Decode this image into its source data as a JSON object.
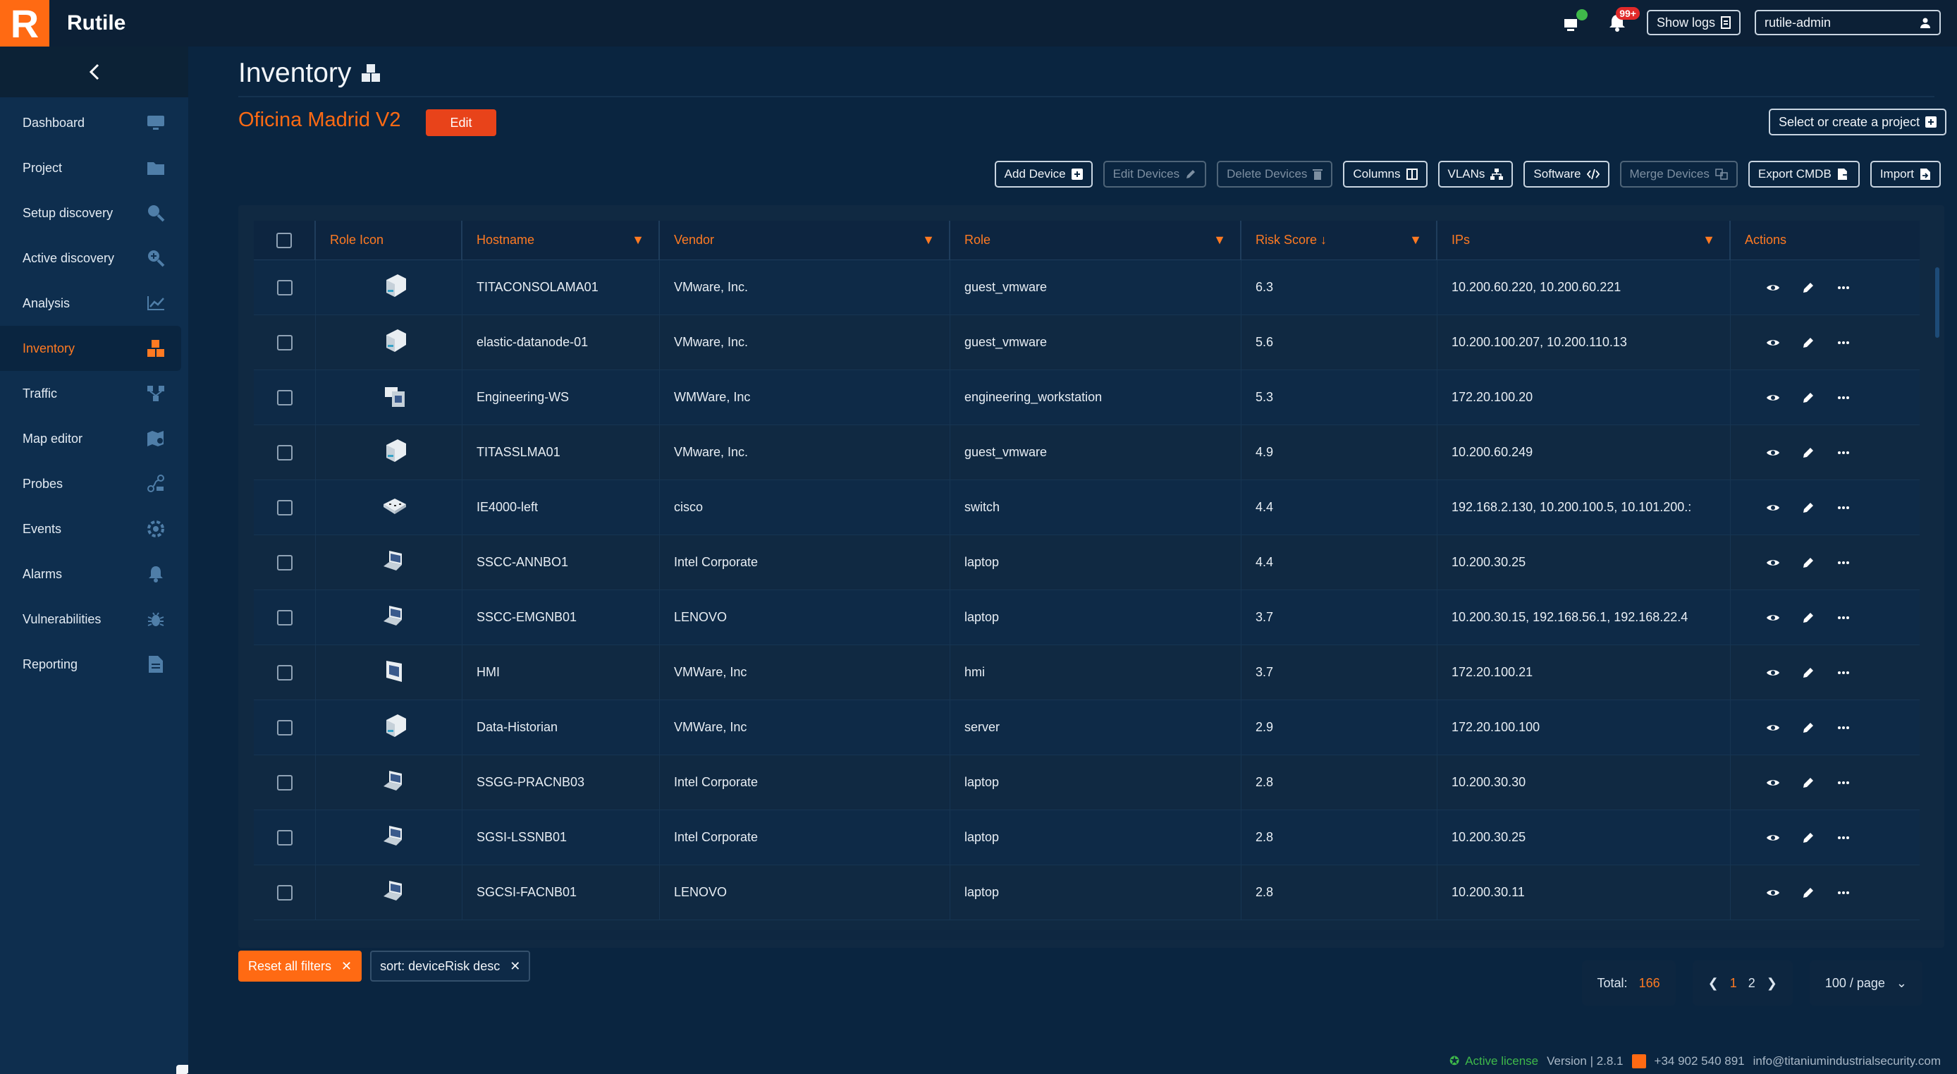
{
  "app": {
    "name": "Rutile",
    "logo_letter": "R"
  },
  "topbar": {
    "notif_badge": "99+",
    "show_logs": "Show logs",
    "user": "rutile-admin"
  },
  "sidebar": {
    "items": [
      {
        "label": "Dashboard",
        "icon": "monitor-icon"
      },
      {
        "label": "Project",
        "icon": "folder-icon"
      },
      {
        "label": "Setup discovery",
        "icon": "search-icon"
      },
      {
        "label": "Active discovery",
        "icon": "zoom-in-icon"
      },
      {
        "label": "Analysis",
        "icon": "chart-icon"
      },
      {
        "label": "Inventory",
        "icon": "inventory-icon",
        "active": true
      },
      {
        "label": "Traffic",
        "icon": "network-icon"
      },
      {
        "label": "Map editor",
        "icon": "map-icon"
      },
      {
        "label": "Probes",
        "icon": "probe-icon"
      },
      {
        "label": "Events",
        "icon": "gear-icon"
      },
      {
        "label": "Alarms",
        "icon": "bell-icon"
      },
      {
        "label": "Vulnerabilities",
        "icon": "bug-icon"
      },
      {
        "label": "Reporting",
        "icon": "document-icon"
      }
    ]
  },
  "page": {
    "title": "Inventory",
    "project_name": "Oficina Madrid V2",
    "edit_label": "Edit",
    "select_project": "Select or create a project"
  },
  "toolbar": {
    "add_device": "Add Device",
    "edit_devices": "Edit Devices",
    "delete_devices": "Delete Devices",
    "columns": "Columns",
    "vlans": "VLANs",
    "software": "Software",
    "merge_devices": "Merge Devices",
    "export_cmdb": "Export CMDB",
    "import": "Import"
  },
  "table": {
    "headers": [
      "Role Icon",
      "Hostname",
      "Vendor",
      "Role",
      "Risk Score",
      "IPs",
      "Actions"
    ],
    "rows": [
      {
        "icon": "vm",
        "hostname": "TITACONSOLAMA01",
        "vendor": "VMware, Inc.",
        "role": "guest_vmware",
        "risk": "6.3",
        "ips": "10.200.60.220, 10.200.60.221"
      },
      {
        "icon": "vm",
        "hostname": "elastic-datanode-01",
        "vendor": "VMware, Inc.",
        "role": "guest_vmware",
        "risk": "5.6",
        "ips": "10.200.100.207, 10.200.110.13"
      },
      {
        "icon": "ws",
        "hostname": "Engineering-WS",
        "vendor": "WMWare, Inc",
        "role": "engineering_workstation",
        "risk": "5.3",
        "ips": "172.20.100.20"
      },
      {
        "icon": "vm",
        "hostname": "TITASSLMA01",
        "vendor": "VMware, Inc.",
        "role": "guest_vmware",
        "risk": "4.9",
        "ips": "10.200.60.249"
      },
      {
        "icon": "switch",
        "hostname": "IE4000-left",
        "vendor": "cisco",
        "role": "switch",
        "risk": "4.4",
        "ips": "192.168.2.130, 10.200.100.5, 10.101.200.:"
      },
      {
        "icon": "laptop",
        "hostname": "SSCC-ANNBO1",
        "vendor": "Intel Corporate",
        "role": "laptop",
        "risk": "4.4",
        "ips": "10.200.30.25"
      },
      {
        "icon": "laptop",
        "hostname": "SSCC-EMGNB01",
        "vendor": "LENOVO",
        "role": "laptop",
        "risk": "3.7",
        "ips": "10.200.30.15, 192.168.56.1, 192.168.22.4"
      },
      {
        "icon": "hmi",
        "hostname": "HMI",
        "vendor": "VMWare, Inc",
        "role": "hmi",
        "risk": "3.7",
        "ips": "172.20.100.21"
      },
      {
        "icon": "vm",
        "hostname": "Data-Historian",
        "vendor": "VMWare, Inc",
        "role": "server",
        "risk": "2.9",
        "ips": "172.20.100.100"
      },
      {
        "icon": "laptop",
        "hostname": "SSGG-PRACNB03",
        "vendor": "Intel Corporate",
        "role": "laptop",
        "risk": "2.8",
        "ips": "10.200.30.30"
      },
      {
        "icon": "laptop",
        "hostname": "SGSI-LSSNB01",
        "vendor": "Intel Corporate",
        "role": "laptop",
        "risk": "2.8",
        "ips": "10.200.30.25"
      },
      {
        "icon": "laptop",
        "hostname": "SGCSI-FACNB01",
        "vendor": "LENOVO",
        "role": "laptop",
        "risk": "2.8",
        "ips": "10.200.30.11"
      }
    ]
  },
  "filters": {
    "reset": "Reset all filters",
    "sort_chip": "sort: deviceRisk desc"
  },
  "pagination": {
    "total_label": "Total:",
    "total_value": "166",
    "pages": [
      "1",
      "2"
    ],
    "current": "1",
    "per_page": "100 / page"
  },
  "footer": {
    "license": "Active license",
    "version": "Version | 2.8.1",
    "phone": "+34 902 540 891",
    "email": "info@titaniumindustrialsecurity.com"
  },
  "colors": {
    "accent": "#ff6a13",
    "bg": "#0a2540",
    "sidebar": "#0e2e4e",
    "license": "#3fb94a"
  }
}
